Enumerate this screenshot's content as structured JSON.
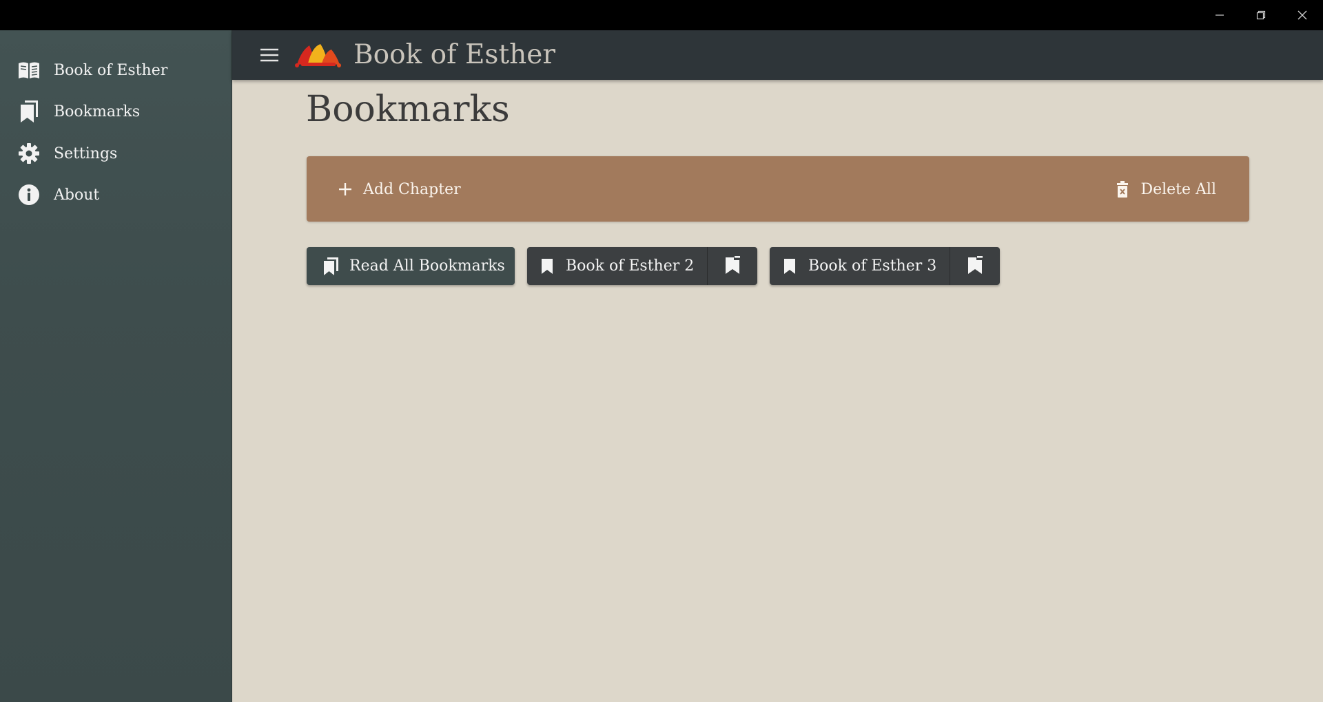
{
  "window": {
    "controls": [
      "minimize-icon",
      "maximize-icon",
      "close-icon"
    ]
  },
  "sidebar": {
    "items": [
      {
        "label": "Book of Esther",
        "icon": "open-book-icon"
      },
      {
        "label": "Bookmarks",
        "icon": "bookmarks-icon"
      },
      {
        "label": "Settings",
        "icon": "gear-icon"
      },
      {
        "label": "About",
        "icon": "info-icon"
      }
    ]
  },
  "appbar": {
    "menu_icon": "hamburger-icon",
    "logo": "jester-hat-logo",
    "title": "Book of Esther"
  },
  "main": {
    "page_title": "Bookmarks",
    "actions": {
      "add_label": "Add Chapter",
      "delete_label": "Delete All"
    },
    "read_all_label": "Read All Bookmarks",
    "bookmarks": [
      {
        "label": "Book of Esther 2"
      },
      {
        "label": "Book of Esther 3"
      }
    ]
  },
  "colors": {
    "sidebar": "#3e4d4d",
    "appbar": "#2e3539",
    "background": "#ddd7ca",
    "action_bar": "#a27a5c",
    "chip_dark": "#3c3f41",
    "chip_teal": "#3f4c4c"
  }
}
